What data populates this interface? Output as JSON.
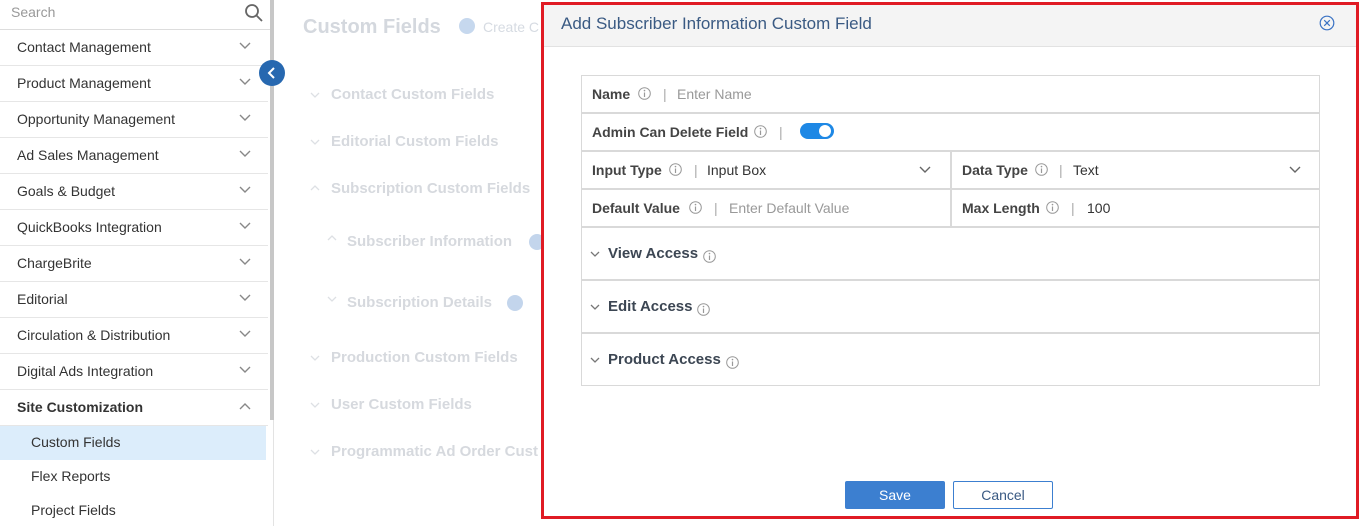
{
  "search": {
    "placeholder": "Search"
  },
  "sidebar": {
    "items": [
      {
        "label": "Contact Management"
      },
      {
        "label": "Product Management"
      },
      {
        "label": "Opportunity Management"
      },
      {
        "label": "Ad Sales Management"
      },
      {
        "label": "Goals & Budget"
      },
      {
        "label": "QuickBooks Integration"
      },
      {
        "label": "ChargeBrite"
      },
      {
        "label": "Editorial"
      },
      {
        "label": "Circulation & Distribution"
      },
      {
        "label": "Digital Ads Integration"
      },
      {
        "label": "Site Customization"
      }
    ],
    "sub_items": [
      {
        "label": "Custom Fields"
      },
      {
        "label": "Flex Reports"
      },
      {
        "label": "Project Fields"
      }
    ]
  },
  "main": {
    "title": "Custom Fields",
    "create_label": "Create C",
    "groups": [
      {
        "label": "Contact Custom Fields"
      },
      {
        "label": "Editorial Custom Fields"
      },
      {
        "label": "Subscription Custom Fields"
      },
      {
        "label": "Subscriber Information"
      },
      {
        "label": "Subscription Details"
      },
      {
        "label": "Production Custom Fields"
      },
      {
        "label": "User Custom Fields"
      },
      {
        "label": "Programmatic Ad Order Cust"
      }
    ]
  },
  "modal": {
    "title": "Add Subscriber Information Custom Field",
    "fields": {
      "name": {
        "label": "Name",
        "placeholder": "Enter Name"
      },
      "admin_delete": {
        "label": "Admin Can Delete Field",
        "enabled": true
      },
      "input_type": {
        "label": "Input Type",
        "value": "Input Box"
      },
      "data_type": {
        "label": "Data Type",
        "value": "Text"
      },
      "default_value": {
        "label": "Default Value",
        "placeholder": "Enter Default Value"
      },
      "max_length": {
        "label": "Max Length",
        "value": "100"
      }
    },
    "accordions": [
      {
        "label": "View Access"
      },
      {
        "label": "Edit Access"
      },
      {
        "label": "Product Access"
      }
    ],
    "save_label": "Save",
    "cancel_label": "Cancel"
  },
  "colors": {
    "accent": "#3c7fd0",
    "highlight_border": "#e01b24",
    "active_item_bg": "#dcedfb"
  }
}
